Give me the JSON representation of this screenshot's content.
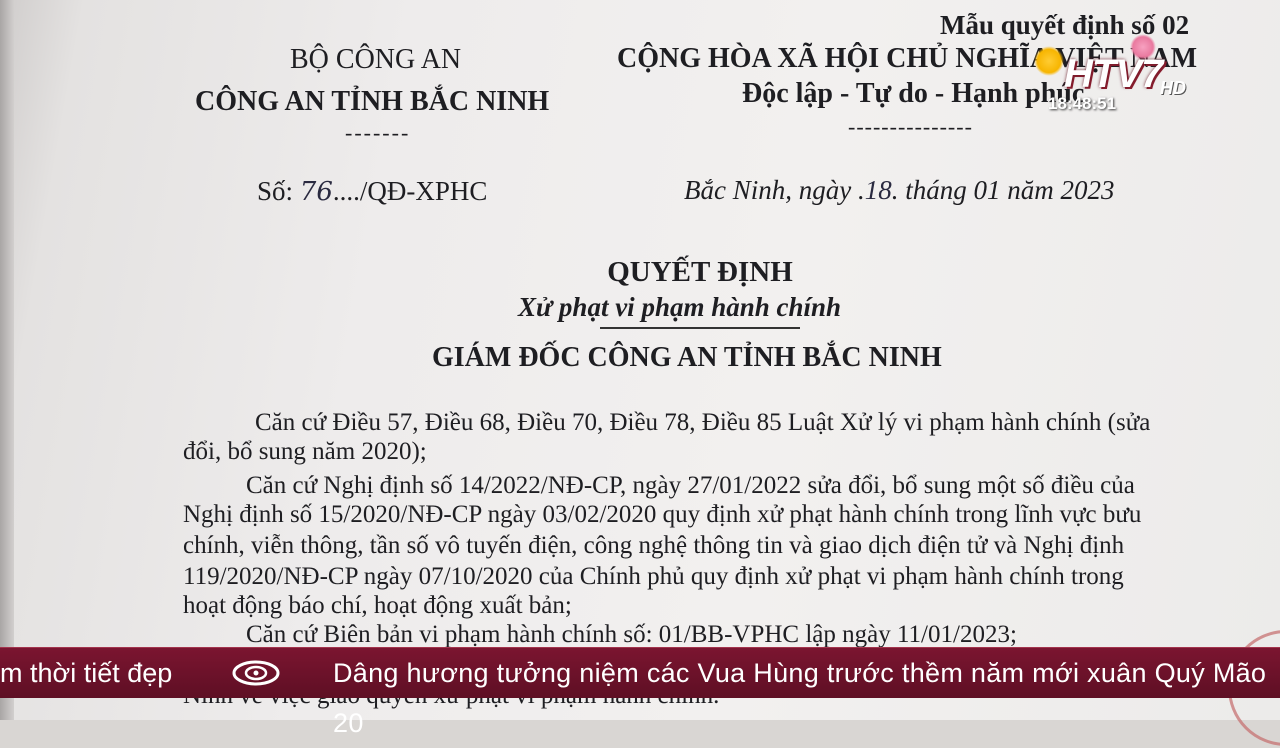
{
  "document": {
    "form_number": "Mẫu quyết định số 02",
    "ministry": "BỘ CÔNG AN",
    "department": "CÔNG AN TỈNH BẮC NINH",
    "dash_left": "-------",
    "republic": "CỘNG HÒA XÃ HỘI CHỦ NGHĨA VIỆT NAM",
    "motto": "Độc lập - Tự do - Hạnh phúc",
    "dash_right": "---------------",
    "docno_prefix": "Số: ",
    "docno_hand": "76",
    "docno_suffix": "..../QĐ-XPHC",
    "place_date_prefix": "Bắc Ninh, ngày .",
    "place_date_hand": "18",
    "place_date_suffix": ". tháng 01 năm 2023",
    "title": "QUYẾT ĐỊNH",
    "subtitle": "Xử phạt vi phạm hành chính",
    "issuer": "GIÁM ĐỐC CÔNG AN TỈNH BẮC NINH",
    "p1_line1": "Căn cứ Điều 57, Điều 68, Điều 70, Điều 78, Điều 85 Luật Xử lý vi phạm hành chính (sửa",
    "p1_line2": "đổi, bổ sung năm 2020);",
    "p2_line1": "Căn cứ  Nghị định số 14/2022/NĐ-CP, ngày 27/01/2022 sửa đổi, bổ sung một số điều của",
    "p2_line2": "Nghị định số 15/2020/NĐ-CP ngày 03/02/2020 quy định xử phạt hành chính trong lĩnh vực bưu",
    "p2_line3": "chính, viễn thông, tần số vô tuyến điện, công nghệ thông tin và giao dịch điện tử và Nghị định",
    "p2_line4": "119/2020/NĐ-CP ngày 07/10/2020 của Chính phủ quy định xử phạt vi phạm hành chính trong",
    "p2_line5": "hoạt động báo chí, hoạt động xuất bản;",
    "p3_line1": "Căn cứ Biên bản vi phạm hành chính số: 01/BB-VPHC lập ngày 11/01/2023;",
    "p4_line2": "Ninh về việc giao quyền xử phạt vi phạm hành chính."
  },
  "overlay": {
    "channel_logo": "HTV7",
    "channel_hd": "HD",
    "clock": "18:48:51",
    "ticker_left": "m thời tiết đẹp",
    "ticker_icon": "htv-ring-logo-icon",
    "ticker_main": "Dâng hương tưởng niệm các Vua Hùng trước thềm năm mới xuân Quý Mão 20"
  },
  "colors": {
    "ticker_bg": "#6b1229",
    "paper": "#efedec",
    "ink": "#1e1e22"
  }
}
